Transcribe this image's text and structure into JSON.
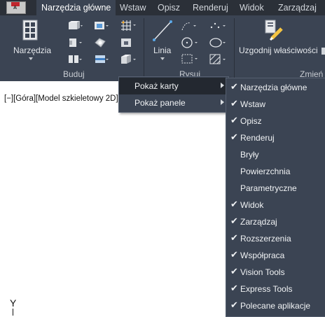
{
  "app": {
    "logo_letter": "A"
  },
  "tabs": [
    {
      "label": "Narzędzia główne",
      "active": true
    },
    {
      "label": "Wstaw"
    },
    {
      "label": "Opisz"
    },
    {
      "label": "Renderuj"
    },
    {
      "label": "Widok"
    },
    {
      "label": "Zarządzaj"
    }
  ],
  "ribbon": {
    "big_buttons": {
      "narzedzia": "Narzędzia",
      "linia": "Linia",
      "uzgodnij": "Uzgodnij właściwości"
    },
    "panels": {
      "buduj": "Buduj",
      "rysuj": "Rysuj",
      "zmien": "Zmień"
    }
  },
  "viewport": {
    "label": "[−][Góra][Model szkieletowy 2D]",
    "ucs_axis": "Y"
  },
  "context_menu": {
    "items": [
      {
        "label": "Pokaż karty",
        "highlighted": true
      },
      {
        "label": "Pokaż panele",
        "highlighted": false
      }
    ]
  },
  "submenu": {
    "check_glyph": "✔",
    "items": [
      {
        "label": "Narzędzia główne",
        "checked": true
      },
      {
        "label": "Wstaw",
        "checked": true
      },
      {
        "label": "Opisz",
        "checked": true
      },
      {
        "label": "Renderuj",
        "checked": true
      },
      {
        "label": "Bryły",
        "checked": false
      },
      {
        "label": "Powierzchnia",
        "checked": false
      },
      {
        "label": "Parametryczne",
        "checked": false
      },
      {
        "label": "Widok",
        "checked": true
      },
      {
        "label": "Zarządzaj",
        "checked": true
      },
      {
        "label": "Rozszerzenia",
        "checked": true
      },
      {
        "label": "Współpraca",
        "checked": true
      },
      {
        "label": "Vision Tools",
        "checked": true
      },
      {
        "label": "Express Tools",
        "checked": true
      },
      {
        "label": "Polecane aplikacje",
        "checked": true
      }
    ]
  },
  "colors": {
    "ribbon_bg": "#3b4453",
    "tabbar_bg": "#2b3038",
    "menu_highlight": "#232830",
    "text_light": "#f0f2f4"
  }
}
